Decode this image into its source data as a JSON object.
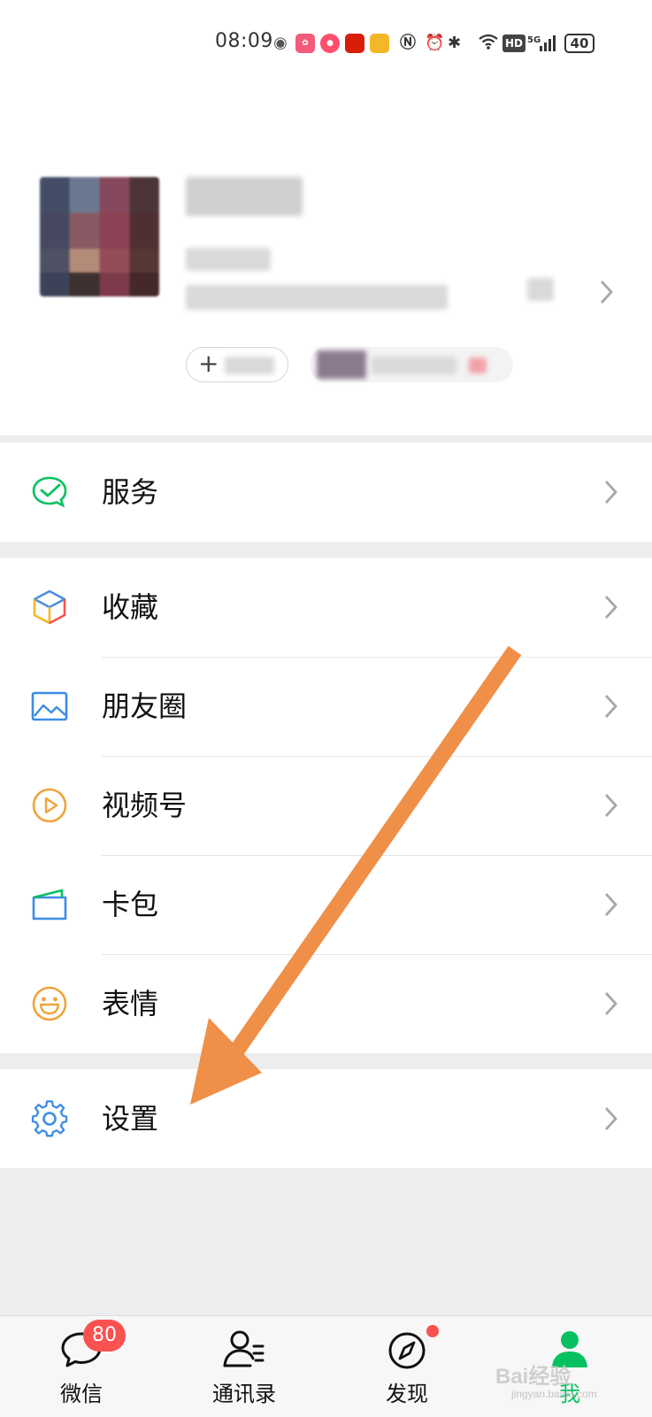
{
  "status_bar": {
    "time": "08:09",
    "battery": "40",
    "network": "5G",
    "hd_label": "HD",
    "app_icons": [
      "wechat-icon",
      "app-icon-1",
      "app-icon-2",
      "app-icon-3",
      "app-icon-4"
    ]
  },
  "menu": {
    "services": {
      "label": "服务"
    },
    "group2": [
      {
        "label": "收藏",
        "icon": "favorites-cube-icon"
      },
      {
        "label": "朋友圈",
        "icon": "moments-picture-icon"
      },
      {
        "label": "视频号",
        "icon": "channels-play-icon"
      },
      {
        "label": "卡包",
        "icon": "card-wallet-icon"
      },
      {
        "label": "表情",
        "icon": "sticker-smile-icon"
      }
    ],
    "settings": {
      "label": "设置"
    }
  },
  "tab_bar": {
    "tabs": [
      {
        "label": "微信",
        "icon": "chat-bubble-icon",
        "badge": "80"
      },
      {
        "label": "通讯录",
        "icon": "contacts-icon"
      },
      {
        "label": "发现",
        "icon": "compass-icon"
      },
      {
        "label": "我",
        "icon": "me-person-icon",
        "active": true
      }
    ]
  },
  "colors": {
    "accent_green": "#07c160",
    "badge_red": "#fa5151",
    "annotation_arrow": "#ef8f48"
  },
  "watermark": {
    "brand": "Bai经验",
    "url": "jingyan.baidu.com"
  }
}
